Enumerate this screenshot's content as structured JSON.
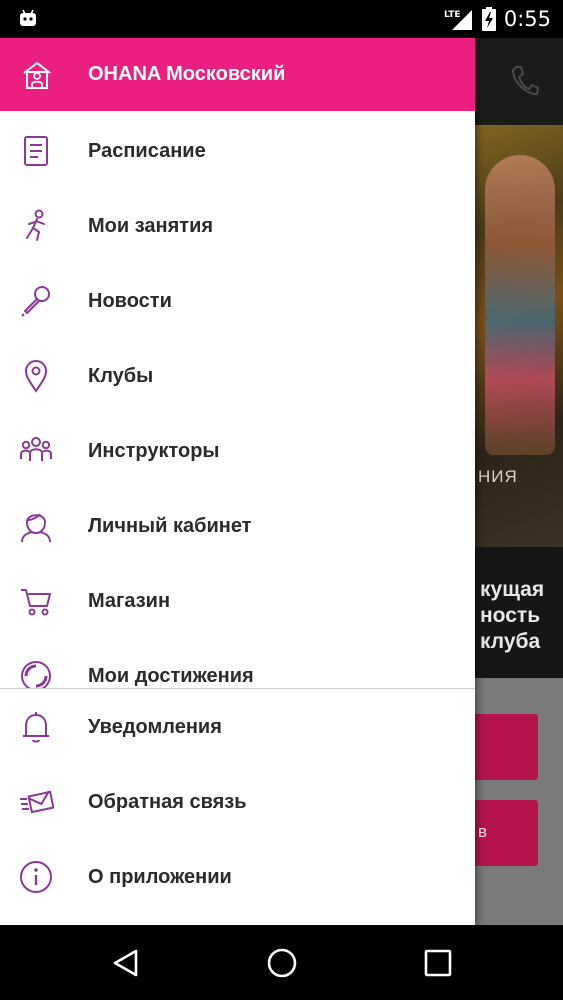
{
  "status_bar": {
    "time": "0:55",
    "network": "LTE"
  },
  "background_app": {
    "hero_caption": "НИЯ",
    "info_text": "кущая\nность\nклуба",
    "button_text": "в"
  },
  "drawer": {
    "header_title": "OHANA Московский",
    "items": [
      {
        "label": "Расписание",
        "icon": "schedule-icon"
      },
      {
        "label": "Мои занятия",
        "icon": "running-person-icon"
      },
      {
        "label": "Новости",
        "icon": "microphone-icon"
      },
      {
        "label": "Клубы",
        "icon": "location-pin-icon"
      },
      {
        "label": "Инструкторы",
        "icon": "people-icon"
      },
      {
        "label": "Личный кабинет",
        "icon": "user-avatar-icon"
      },
      {
        "label": "Магазин",
        "icon": "cart-icon"
      },
      {
        "label": "Мои достижения",
        "icon": "achievements-icon"
      }
    ],
    "footer_items": [
      {
        "label": "Уведомления",
        "icon": "bell-icon"
      },
      {
        "label": "Обратная связь",
        "icon": "envelope-icon"
      },
      {
        "label": "О приложении",
        "icon": "info-icon"
      }
    ]
  },
  "colors": {
    "accent": "#ea1f80",
    "icon_purple": "#8a3a96",
    "statusbar": "#000000"
  }
}
